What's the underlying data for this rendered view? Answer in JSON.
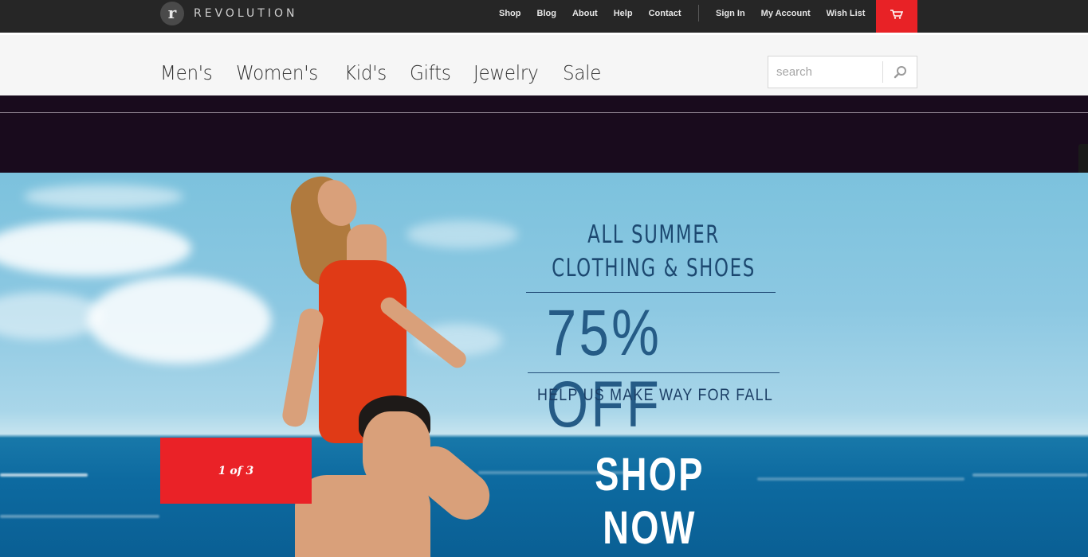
{
  "brand": {
    "mark": "r",
    "name": "REVOLUTION"
  },
  "topnav": {
    "links": [
      "Shop",
      "Blog",
      "About",
      "Help",
      "Contact"
    ],
    "account_links": [
      "Sign In",
      "My Account",
      "Wish List"
    ]
  },
  "mainnav": {
    "items": [
      "Men's",
      "Women's",
      "Kid's",
      "Gifts",
      "Jewelry",
      "Sale"
    ]
  },
  "search": {
    "placeholder": "search"
  },
  "hero": {
    "line1": "ALL SUMMER",
    "line2": "CLOTHING & SHOES",
    "discount": "75% OFF",
    "subline": "HELP US MAKE WAY FOR FALL",
    "cta": "SHOP NOW",
    "slide_indicator": "1 of 3"
  },
  "colors": {
    "accent": "#e82226",
    "topbar": "#262626",
    "band": "#190b1d",
    "promo_text": "#1f4e78"
  }
}
